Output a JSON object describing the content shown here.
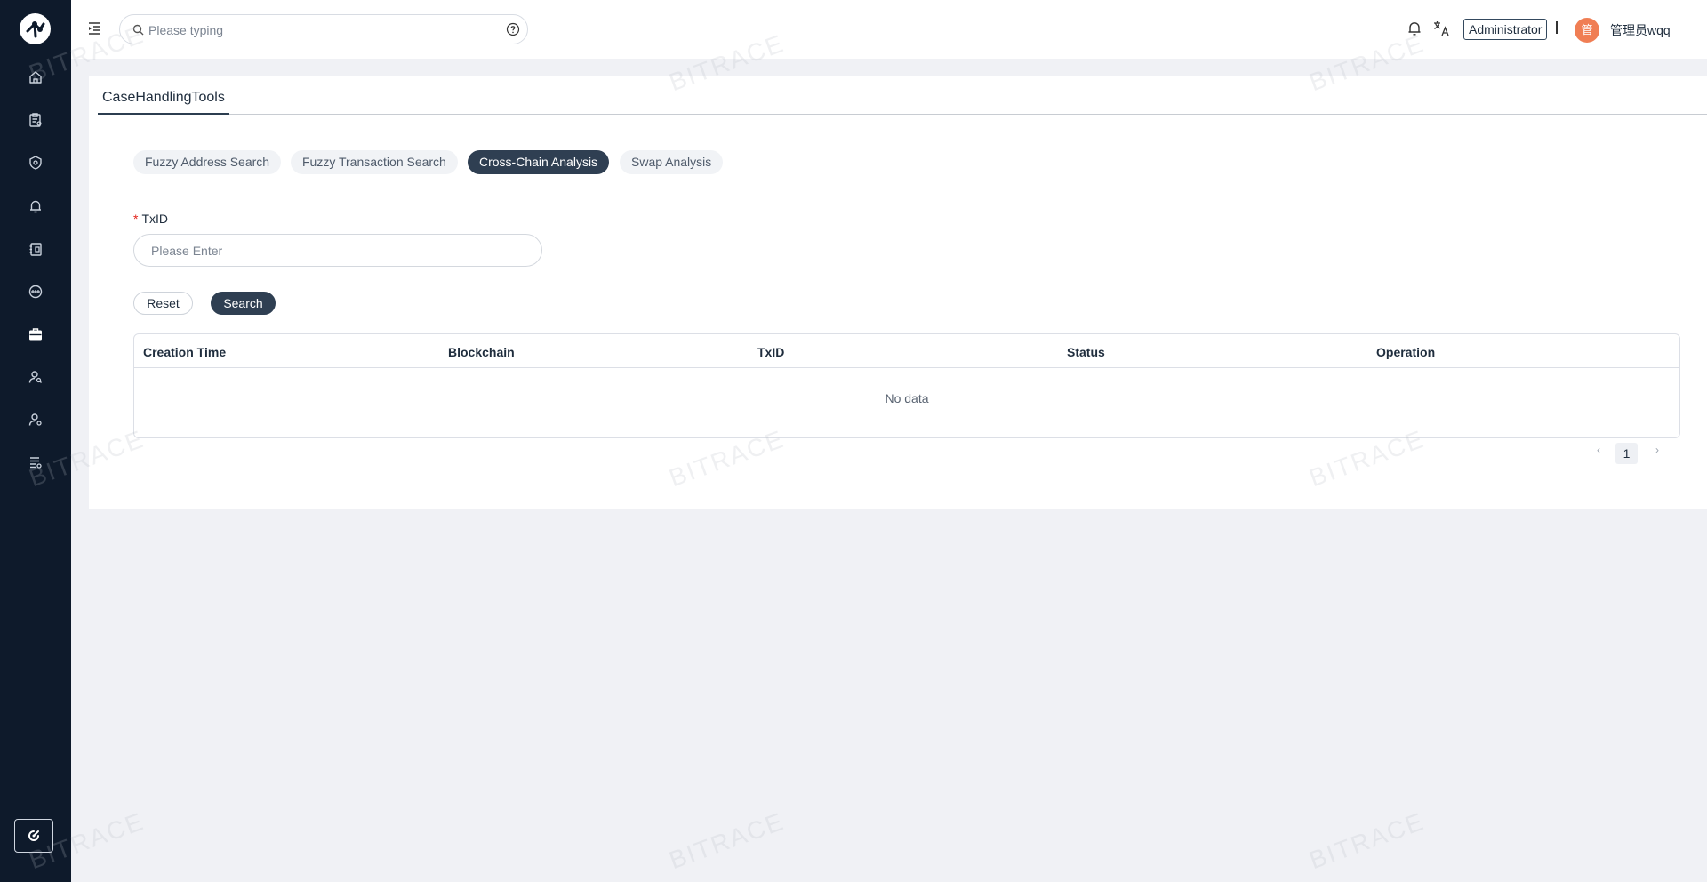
{
  "header": {
    "search_placeholder": "Please typing",
    "role_badge": "Administrator",
    "divider": "|",
    "avatar_text": "管",
    "username": "管理员wqq"
  },
  "page": {
    "tab": "CaseHandlingTools",
    "segments": [
      {
        "label": "Fuzzy Address Search",
        "active": false
      },
      {
        "label": "Fuzzy Transaction Search",
        "active": false
      },
      {
        "label": "Cross-Chain Analysis",
        "active": true
      },
      {
        "label": "Swap Analysis",
        "active": false
      }
    ],
    "form": {
      "required_mark": "*",
      "label": "TxID",
      "placeholder": "Please Enter",
      "value": ""
    },
    "buttons": {
      "reset": "Reset",
      "search": "Search"
    },
    "table": {
      "columns": [
        "Creation Time",
        "Blockchain",
        "TxID",
        "Status",
        "Operation"
      ],
      "rows": [],
      "empty_text": "No data"
    },
    "pagination": {
      "prev": "‹",
      "current": "1",
      "next": "›"
    }
  },
  "sidebar": {
    "items": [
      {
        "icon": "home-icon"
      },
      {
        "icon": "case-report-icon"
      },
      {
        "icon": "shield-icon"
      },
      {
        "icon": "alert-bell-icon"
      },
      {
        "icon": "notebook-icon"
      },
      {
        "icon": "chain-icon"
      },
      {
        "icon": "toolbox-icon"
      },
      {
        "icon": "user-search-icon"
      },
      {
        "icon": "user-settings-icon"
      },
      {
        "icon": "list-settings-icon"
      }
    ],
    "bottom_icon": "refresh-icon"
  },
  "watermark": "BITRACE",
  "colors": {
    "sidebar_bg": "#0e1a2b",
    "accent": "#2f3f52",
    "avatar": "#f07e54",
    "required": "#e2231a"
  }
}
